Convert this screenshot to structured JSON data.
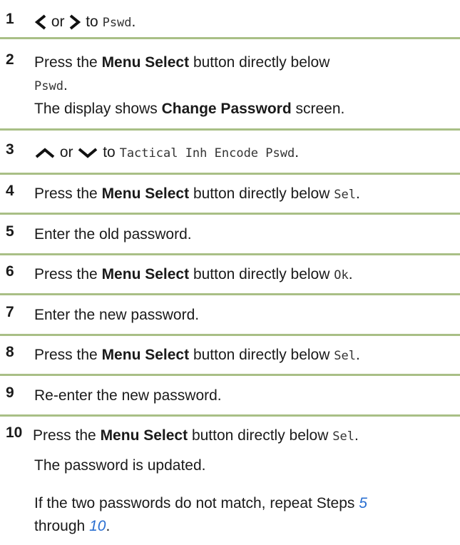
{
  "steps": [
    {
      "num": "1",
      "or": "or",
      "to": "to",
      "term": "Pswd",
      "end": "."
    },
    {
      "num": "2",
      "pre": "Press the",
      "bold": "Menu Select",
      "mid": "button directly below",
      "term": "Pswd",
      "end": ".",
      "line2_pre": "The display shows",
      "line2_bold": "Change Password",
      "line2_post": "screen."
    },
    {
      "num": "3",
      "or": "or",
      "to": "to",
      "term": "Tactical Inh Encode Pswd",
      "end": "."
    },
    {
      "num": "4",
      "pre": "Press the",
      "bold": "Menu Select",
      "mid": "button directly below",
      "term": "Sel",
      "end": "."
    },
    {
      "num": "5",
      "text": "Enter the old password."
    },
    {
      "num": "6",
      "pre": "Press the",
      "bold": "Menu Select",
      "mid": "button directly below",
      "term": "Ok",
      "end": "."
    },
    {
      "num": "7",
      "text": "Enter the new password."
    },
    {
      "num": "8",
      "pre": "Press the",
      "bold": "Menu Select",
      "mid": "button directly below",
      "term": "Sel",
      "end": "."
    },
    {
      "num": "9",
      "text": "Re-enter the new password."
    },
    {
      "num": "10",
      "pre": "Press the",
      "bold": "Menu Select",
      "mid": "button directly below",
      "term": "Sel",
      "end": "."
    }
  ],
  "result": "The password is updated.",
  "note": {
    "pre": "If the two passwords do not match, repeat Steps",
    "link1": "5",
    "mid": "through",
    "link2": "10",
    "end": "."
  },
  "colors": {
    "separator": "#a9bf86",
    "link": "#2a6fd1"
  },
  "icons": [
    "chevron-left-icon",
    "chevron-right-icon",
    "chevron-up-icon",
    "chevron-down-icon"
  ]
}
